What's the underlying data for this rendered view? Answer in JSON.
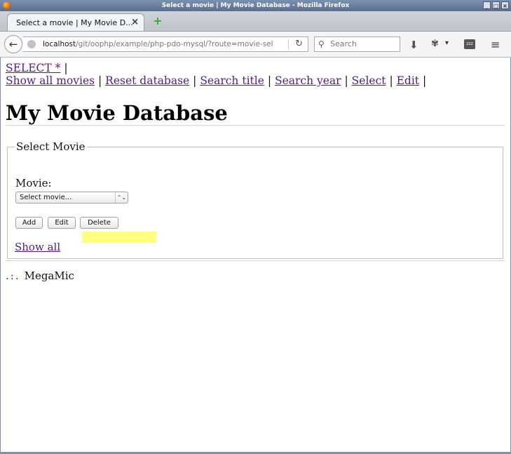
{
  "window": {
    "title": "Select a movie | My Movie Database - Mozilla Firefox",
    "minimize": "_",
    "maximize": "□",
    "close": "×"
  },
  "tab": {
    "title": "Select a movie | My Movie D...",
    "close": "×",
    "new_tab": "+"
  },
  "navbar": {
    "back": "←",
    "url_host": "localhost",
    "url_path": "/git/oophp/example/php-pdo-mysql/?route=movie-sel",
    "reload": "↻",
    "search_placeholder": "Search",
    "search_icon": "⚲",
    "download_icon": "⬇",
    "addon_icon": "✾",
    "addon_chevron": "▾",
    "zzz_label": "zzz",
    "menu_icon": "≡"
  },
  "page": {
    "links_line1": [
      {
        "label": "SELECT *",
        "sep": " |"
      }
    ],
    "links_line2": [
      {
        "label": "Show all movies",
        "sep": " | "
      },
      {
        "label": "Reset database",
        "sep": " | "
      },
      {
        "label": "Search title",
        "sep": " | "
      },
      {
        "label": "Search year",
        "sep": " | "
      },
      {
        "label": "Select",
        "sep": " | "
      },
      {
        "label": "Edit",
        "sep": " |"
      }
    ],
    "title": "My Movie Database",
    "form": {
      "legend": "Select Movie",
      "movie_label": "Movie:",
      "select_value": "Select movie...",
      "select_arrow": "⌃⌄",
      "add": "Add",
      "edit": "Edit",
      "delete": "Delete",
      "show_all": "Show all"
    },
    "footer": {
      "dots": ".:.",
      "name": "MegaMic"
    }
  }
}
